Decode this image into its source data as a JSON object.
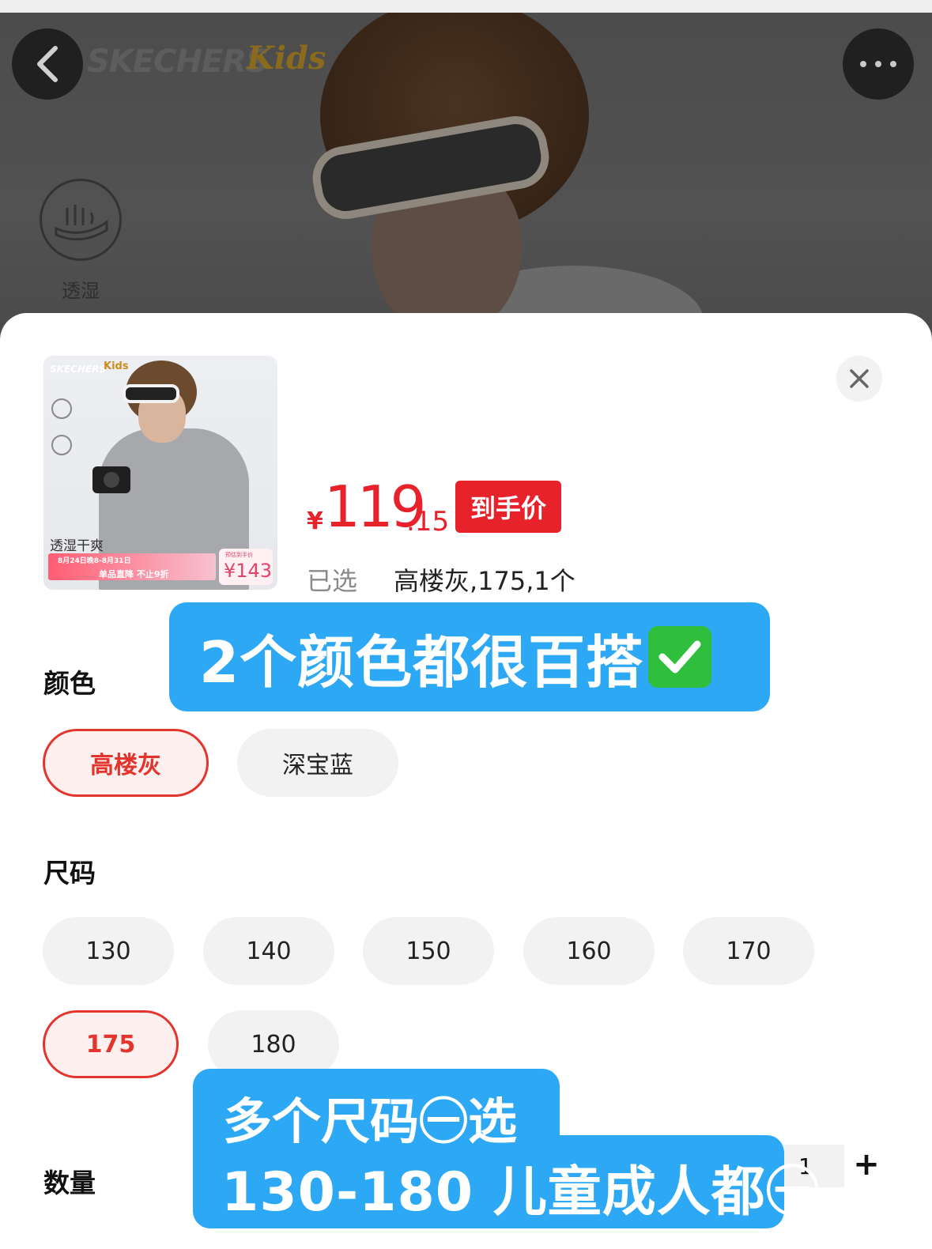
{
  "hero": {
    "brand_logo": "SKECHERS",
    "brand_kids": "Kids",
    "feature_label": "透湿"
  },
  "thumbnail": {
    "brand": "SKECHERS",
    "kids": "Kids",
    "tagline": "透湿干爽",
    "promo_date": "8月24日晚8-8月31日",
    "promo_main": "单品直降 不止9折",
    "promo_price_caption": "预估到手价",
    "promo_price": "¥143"
  },
  "price": {
    "currency": "¥",
    "integer": "119",
    "decimal": ".15",
    "badge": "到手价"
  },
  "selection": {
    "label": "已选",
    "value": "高楼灰,175,1个"
  },
  "color_section": {
    "title": "颜色",
    "options": [
      {
        "label": "高楼灰",
        "selected": true
      },
      {
        "label": "深宝蓝",
        "selected": false
      }
    ]
  },
  "size_section": {
    "title": "尺码",
    "options": [
      {
        "label": "130",
        "selected": false
      },
      {
        "label": "140",
        "selected": false
      },
      {
        "label": "150",
        "selected": false
      },
      {
        "label": "160",
        "selected": false
      },
      {
        "label": "170",
        "selected": false
      },
      {
        "label": "175",
        "selected": true
      },
      {
        "label": "180",
        "selected": false
      }
    ]
  },
  "quantity_section": {
    "title": "数量",
    "value": "1",
    "plus": "+"
  },
  "stickers": {
    "colors_note": "2个颜色都很百搭",
    "sizes_note_line1": "多个尺码㊀选",
    "sizes_note_line2": "130-180 儿童成人都㊀"
  },
  "colors": {
    "accent_red": "#e8222b",
    "sticker_blue": "#2da8f5",
    "check_green": "#2fbf3c"
  }
}
